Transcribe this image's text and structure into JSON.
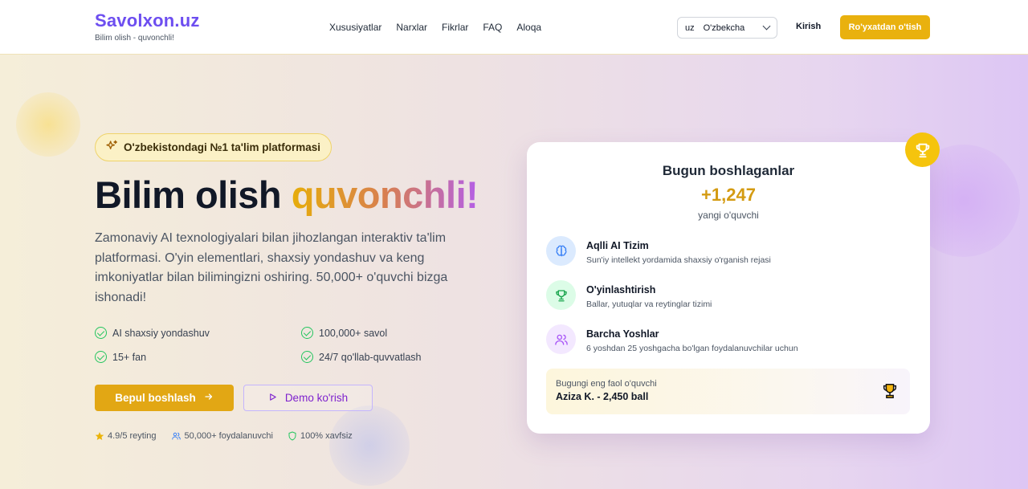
{
  "header": {
    "logo": "Savolxon.uz",
    "tagline": "Bilim olish - quvonchli!",
    "nav": [
      "Xususiyatlar",
      "Narxlar",
      "Fikrlar",
      "FAQ",
      "Aloqa"
    ],
    "language": {
      "code": "uz",
      "label": "O'zbekcha"
    },
    "login_label": "Kirish",
    "register_label": "Ro'yxatdan o'tish"
  },
  "hero": {
    "badge": "O'zbekistondagi №1 ta'lim platformasi",
    "title_part1": "Bilim olish",
    "title_part2": "quvonchli!",
    "description": "Zamonaviy AI texnologiyalari bilan jihozlangan interaktiv ta'lim platformasi. O'yin elementlari, shaxsiy yondashuv va keng imkoniyatlar bilan bilimingizni oshiring. 50,000+ o'quvchi bizga ishonadi!",
    "features": [
      "AI shaxsiy yondashuv",
      "100,000+ savol",
      "15+ fan",
      "24/7 qo'llab-quvvatlash"
    ],
    "primary_button": "Bepul boshlash",
    "secondary_button": "Demo ko'rish",
    "stats": [
      "4.9/5 reyting",
      "50,000+ foydalanuvchi",
      "100% xavfsiz"
    ]
  },
  "card": {
    "title": "Bugun boshlaganlar",
    "count": "+1,247",
    "subtitle": "yangi o'quvchi",
    "items": [
      {
        "title": "Aqlli AI Tizim",
        "desc": "Sun'iy intellekt yordamida shaxsiy o'rganish rejasi",
        "icon": "brain-icon"
      },
      {
        "title": "O'yinlashtirish",
        "desc": "Ballar, yutuqlar va reytinglar tizimi",
        "icon": "trophy-icon"
      },
      {
        "title": "Barcha Yoshlar",
        "desc": "6 yoshdan 25 yoshgacha bo'lgan foydalanuvchilar uchun",
        "icon": "users-icon"
      }
    ],
    "best_label": "Bugungi eng faol o'quvchi",
    "best_value": "Aziza K. - 2,450 ball"
  },
  "colors": {
    "accent": "#e9b10e",
    "brand": "#6d4ef0",
    "purple": "#7e22ce",
    "success": "#22c55e"
  }
}
